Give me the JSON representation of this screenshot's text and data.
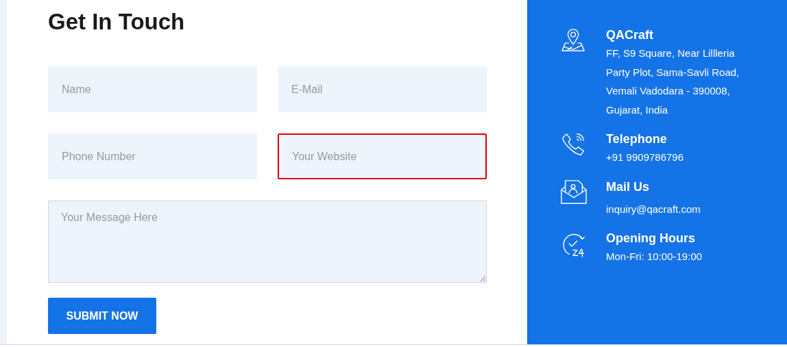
{
  "heading": "Get In Touch",
  "fields": [
    {
      "kind": "input",
      "placeholder": "Name",
      "highlighted": false
    },
    {
      "kind": "input",
      "placeholder": "E-Mail",
      "highlighted": false
    },
    {
      "kind": "input",
      "placeholder": "Phone Number",
      "highlighted": false
    },
    {
      "kind": "input",
      "placeholder": "Your Website",
      "highlighted": true
    },
    {
      "kind": "textarea",
      "placeholder": "Your Message Here",
      "highlighted": false
    }
  ],
  "submit": "SUBMIT NOW",
  "contacts": [
    {
      "kind": "location",
      "title": "QACraft",
      "lines": [
        "FF, S9 Square, Near Lillleria",
        "Party Plot, Sama-Savli Road,",
        "Vemali Vadodara - 390008,",
        "Gujarat, India"
      ]
    },
    {
      "kind": "phone",
      "title": "Telephone",
      "lines": [
        "+91 9909786796"
      ]
    },
    {
      "kind": "mail",
      "title": "Mail Us",
      "lines": [
        "inquiry@qacraft.com"
      ]
    },
    {
      "kind": "hours",
      "title": "Opening Hours",
      "lines": [
        "Mon-Fri: 10:00-19:00"
      ]
    }
  ]
}
